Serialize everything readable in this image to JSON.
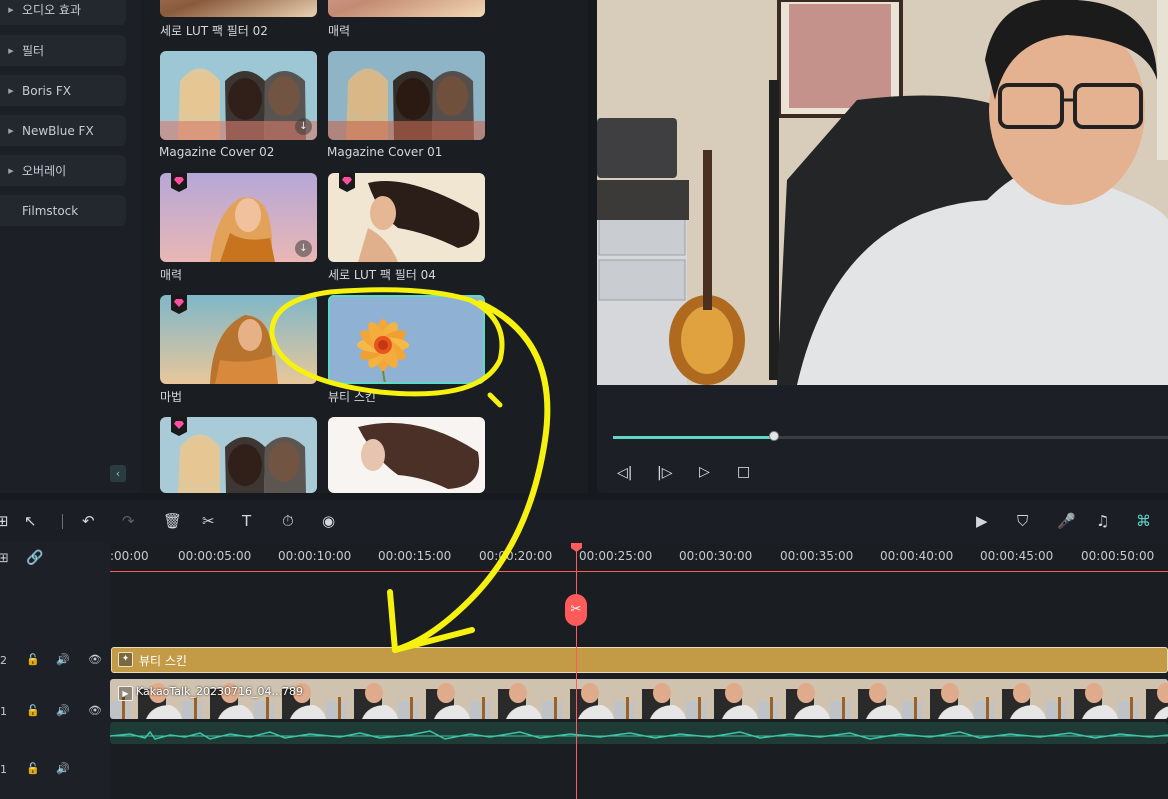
{
  "sidebar": {
    "items": [
      {
        "label": "오디오 효과",
        "arrow": "▶"
      },
      {
        "label": "필터",
        "arrow": "▶"
      },
      {
        "label": "Boris FX",
        "arrow": "▶"
      },
      {
        "label": "NewBlue FX",
        "arrow": "▶"
      },
      {
        "label": "오버레이",
        "arrow": "▶"
      },
      {
        "label": "Filmstock",
        "arrow": ""
      }
    ],
    "collapse_icon": "‹"
  },
  "gallery": {
    "items": [
      {
        "caption": "세로 LUT 팩 필터 02"
      },
      {
        "caption": "매력"
      },
      {
        "caption": "Magazine Cover 02"
      },
      {
        "caption": "Magazine Cover 01"
      },
      {
        "caption": "매력"
      },
      {
        "caption": "세로 LUT 팩 필터 04"
      },
      {
        "caption": "마법"
      },
      {
        "caption": "뷰티 스킨"
      }
    ]
  },
  "preview": {
    "progress": 0.29,
    "accent": "#5fd6c6",
    "controls": {
      "prev": "◁|",
      "next": "|▷",
      "play": "▷",
      "stop": "□"
    }
  },
  "toolbar": {
    "icons": [
      "layout-icon",
      "select-icon",
      "undo-icon",
      "redo-icon",
      "delete-icon",
      "cut-icon",
      "text-icon",
      "speed-icon",
      "audio-icon",
      "render-icon",
      "marker-icon",
      "mic-icon",
      "music-icon",
      "snap-icon"
    ]
  },
  "timeline": {
    "ticks": [
      ":00:00",
      "00:00:05:00",
      "00:00:10:00",
      "00:00:15:00",
      "00:00:20:00",
      "00:00:25:00",
      "00:00:30:00",
      "00:00:35:00",
      "00:00:40:00",
      "00:00:45:00",
      "00:00:50:00"
    ],
    "effect_clip_label": "뷰티 스킨",
    "video_clip_label": "KakaoTalk_20230716_04...789",
    "track_numbers": [
      "2",
      "1",
      "1"
    ],
    "playhead_color": "#ff5b5b",
    "effect_color": "#c39b46"
  }
}
